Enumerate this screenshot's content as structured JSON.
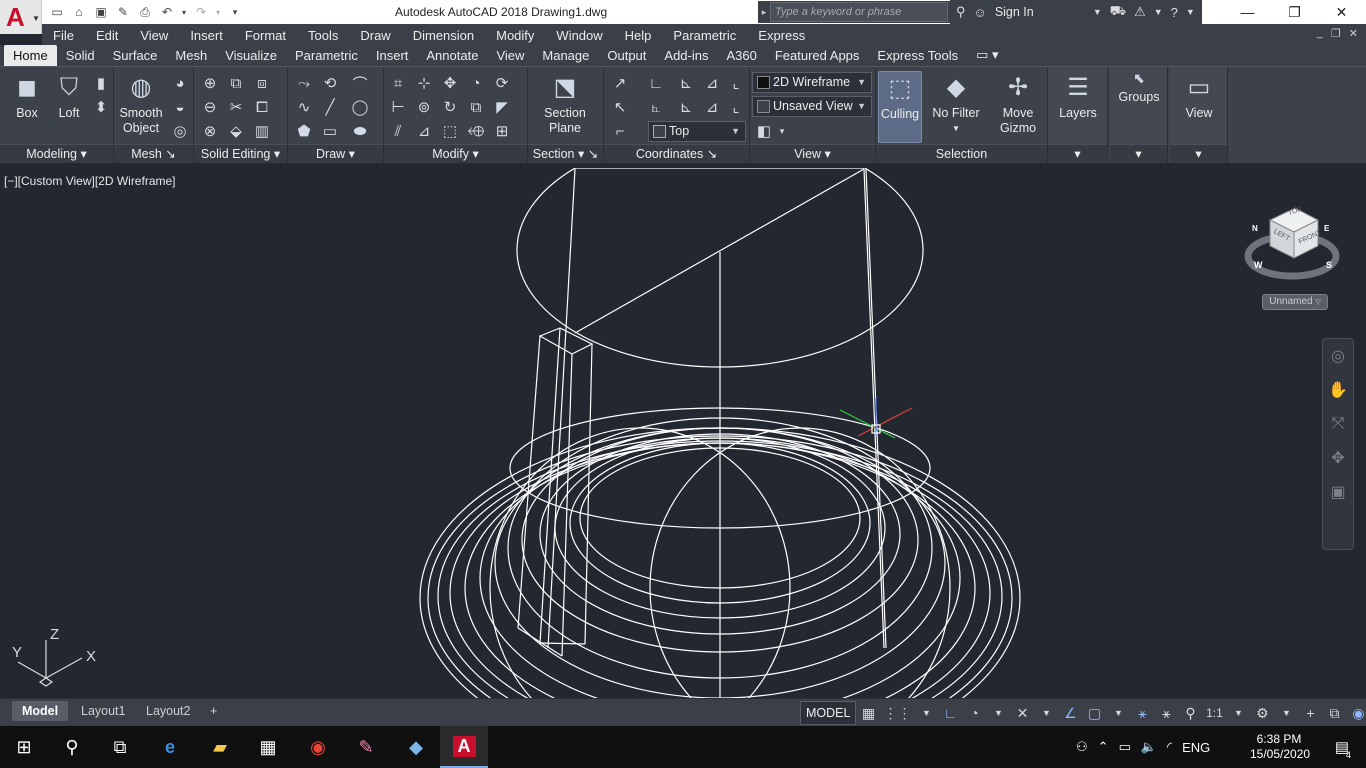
{
  "titlebar": {
    "title": "Autodesk AutoCAD 2018    Drawing1.dwg",
    "search_placeholder": "Type a keyword or phrase",
    "sign_in": "Sign In",
    "app_glyph": "A"
  },
  "menu": [
    "File",
    "Edit",
    "View",
    "Insert",
    "Format",
    "Tools",
    "Draw",
    "Dimension",
    "Modify",
    "Window",
    "Help",
    "Parametric",
    "Express"
  ],
  "tabs": [
    "Home",
    "Solid",
    "Surface",
    "Mesh",
    "Visualize",
    "Parametric",
    "Insert",
    "Annotate",
    "View",
    "Manage",
    "Output",
    "Add-ins",
    "A360",
    "Featured Apps",
    "Express Tools"
  ],
  "active_tab": "Home",
  "ribbon": {
    "panels": {
      "modeling": "Modeling",
      "mesh": "Mesh",
      "solid_editing": "Solid Editing",
      "draw": "Draw",
      "modify": "Modify",
      "section": "Section",
      "coordinates": "Coordinates",
      "view": "View",
      "selection": "Selection"
    },
    "buttons": {
      "box": "Box",
      "loft": "Loft",
      "smooth_object_1": "Smooth",
      "smooth_object_2": "Object",
      "section_plane_1": "Section",
      "section_plane_2": "Plane",
      "culling": "Culling",
      "no_filter": "No Filter",
      "move_gizmo_1": "Move",
      "move_gizmo_2": "Gizmo",
      "layers": "Layers",
      "groups": "Groups",
      "view": "View"
    },
    "dropdowns": {
      "visual_style": "2D Wireframe",
      "named_view": "Unsaved View",
      "ucs_view": "Top"
    }
  },
  "viewport": {
    "label": "[−][Custom View][2D Wireframe]",
    "viewcube_faces": {
      "top": "TOP",
      "left": "LEFT",
      "front": "FRONT"
    },
    "compass": {
      "w": "W",
      "s": "S",
      "n": "N",
      "e": "E"
    },
    "ucs_name": "Unnamed",
    "ucs_axes": {
      "x": "X",
      "y": "Y",
      "z": "Z"
    }
  },
  "layout_tabs": [
    "Model",
    "Layout1",
    "Layout2"
  ],
  "active_layout": "Model",
  "status": {
    "model": "MODEL",
    "scale": "1:1"
  },
  "taskbar": {
    "language": "ENG",
    "time": "6:38 PM",
    "date": "15/05/2020",
    "notifications": "4"
  },
  "colors": {
    "ribbon_bg": "#3d414a",
    "canvas_bg": "#222730",
    "accent": "#5d6b86",
    "autocad_red": "#c8102e"
  }
}
